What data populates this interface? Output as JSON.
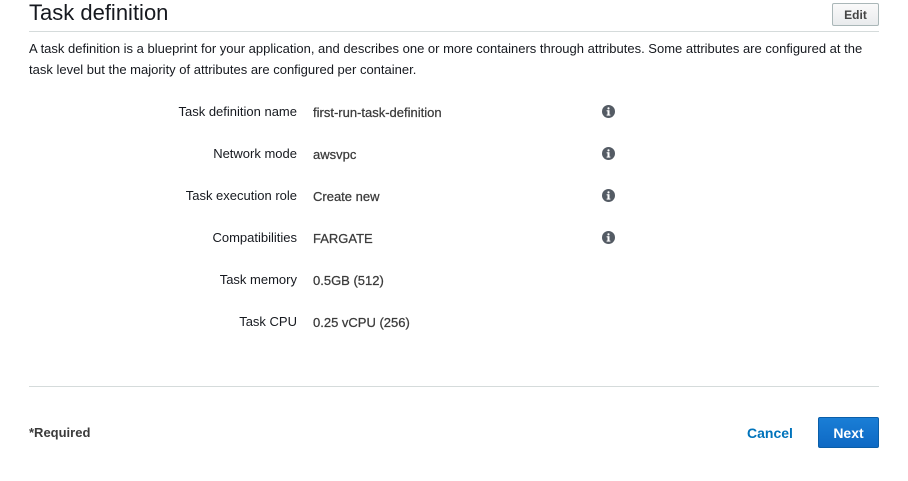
{
  "header": {
    "title": "Task definition",
    "edit_label": "Edit"
  },
  "description": "A task definition is a blueprint for your application, and describes one or more containers through attributes. Some attributes are configured at the task level but the majority of attributes are configured per container.",
  "fields": [
    {
      "label": "Task definition name",
      "value": "first-run-task-definition",
      "has_info": true
    },
    {
      "label": "Network mode",
      "value": "awsvpc",
      "has_info": true
    },
    {
      "label": "Task execution role",
      "value": "Create new",
      "has_info": true
    },
    {
      "label": "Compatibilities",
      "value": "FARGATE",
      "has_info": true
    },
    {
      "label": "Task memory",
      "value": "0.5GB (512)",
      "has_info": false
    },
    {
      "label": "Task CPU",
      "value": "0.25 vCPU (256)",
      "has_info": false
    }
  ],
  "footer": {
    "required_label": "*Required",
    "cancel_label": "Cancel",
    "next_label": "Next"
  },
  "colors": {
    "link_blue": "#0073bb",
    "primary_button": "#0e69c4",
    "divider": "#d5dbdb"
  },
  "icons": {
    "info": "info-icon"
  }
}
